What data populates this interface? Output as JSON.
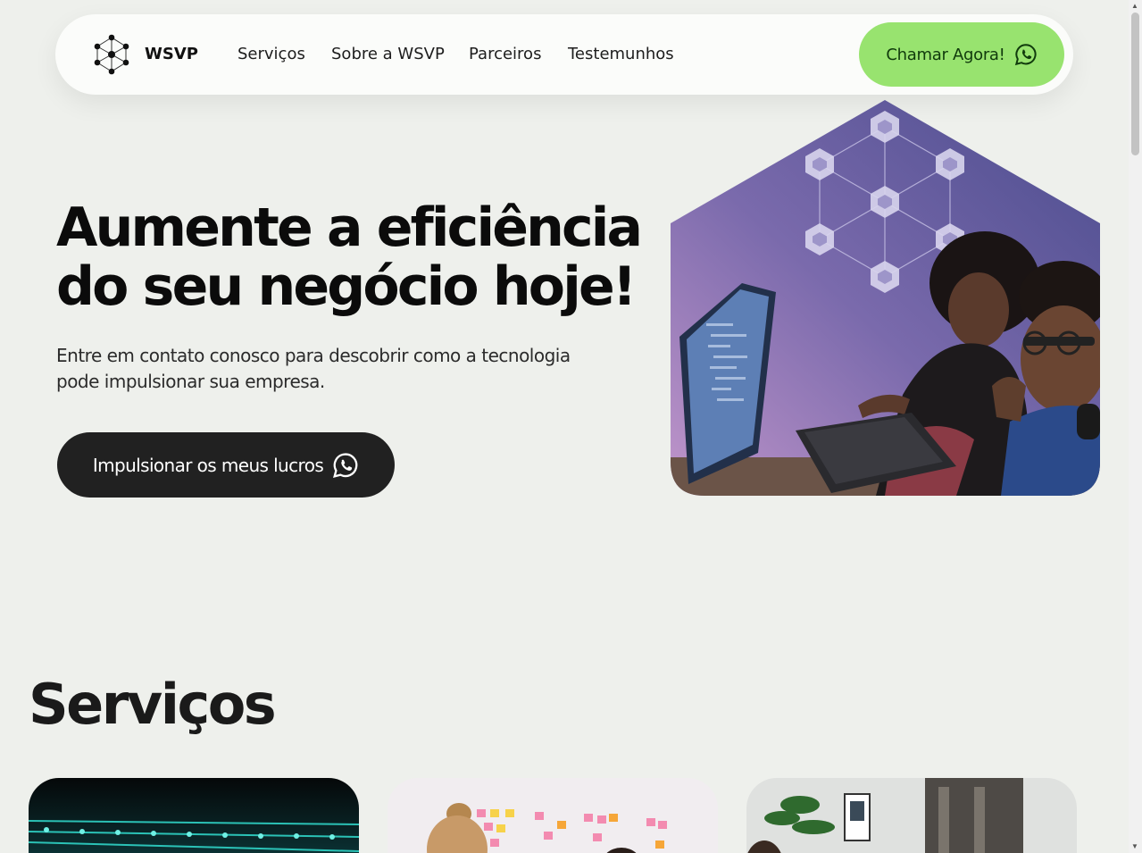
{
  "brand": {
    "name": "WSVP",
    "logo_icon": "network-nodes-icon"
  },
  "nav": {
    "links": [
      "Serviços",
      "Sobre a WSVP",
      "Parceiros",
      "Testemunhos"
    ],
    "cta_label": "Chamar Agora!",
    "cta_icon": "whatsapp-icon"
  },
  "hero": {
    "title_line1": "Aumente a eficiência",
    "title_line2": "do seu negócio hoje!",
    "subtitle": "Entre em contato conosco para descobrir como a tecnologia pode impulsionar sua empresa.",
    "cta_label": "Impulsionar os meus lucros",
    "cta_icon": "whatsapp-icon",
    "image": "two people working at a laptop"
  },
  "services": {
    "title": "Serviços",
    "cards": [
      {
        "image": "circuit board"
      },
      {
        "image": "team meeting with sticky notes"
      },
      {
        "image": "office team"
      }
    ]
  },
  "colors": {
    "background": "#eef0ec",
    "nav_background": "#fbfcfa",
    "accent_green": "#98e36f",
    "dark_button": "#212121",
    "hero_gradient_top": "#5a5a96",
    "hero_gradient_bottom": "#b08cc6"
  }
}
